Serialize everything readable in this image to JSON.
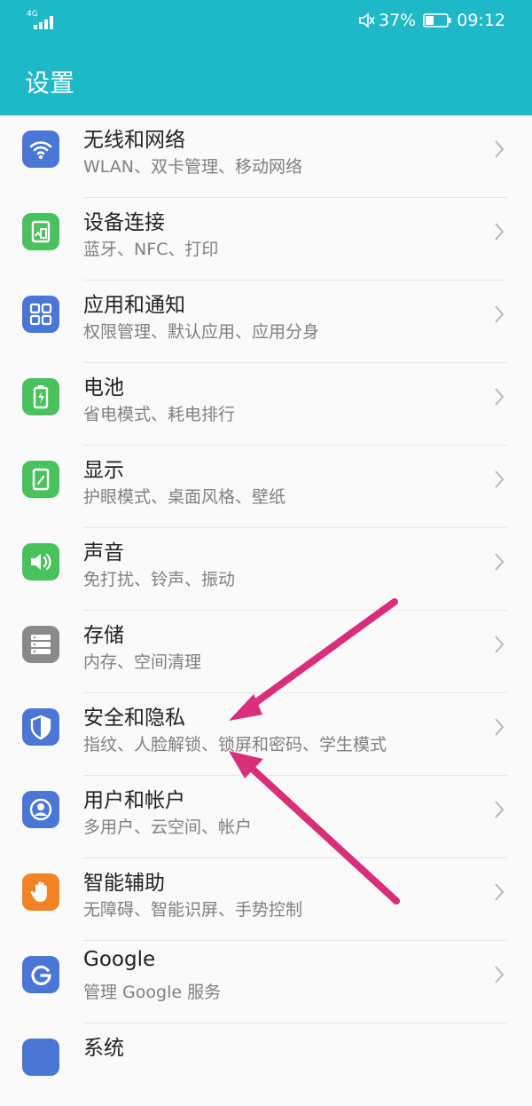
{
  "status_bar": {
    "network": "4G",
    "battery": "37%",
    "time": "09:12",
    "icons": [
      "signal-icon",
      "mute-icon",
      "battery-icon"
    ]
  },
  "app_bar": {
    "title": "设置"
  },
  "colors": {
    "accent": "#1fb8c6",
    "annotation_arrow": "#d92e7a",
    "icon_blue": "#4a76d6",
    "icon_green": "#49c25d",
    "icon_gray": "#8a8a8a",
    "icon_orange": "#f28324"
  },
  "items": [
    {
      "title": "无线和网络",
      "subtitle": "WLAN、双卡管理、移动网络",
      "icon": "wifi-icon"
    },
    {
      "title": "设备连接",
      "subtitle": "蓝牙、NFC、打印",
      "icon": "device-connect-icon"
    },
    {
      "title": "应用和通知",
      "subtitle": "权限管理、默认应用、应用分身",
      "icon": "apps-icon"
    },
    {
      "title": "电池",
      "subtitle": "省电模式、耗电排行",
      "icon": "battery-setting-icon"
    },
    {
      "title": "显示",
      "subtitle": "护眼模式、桌面风格、壁纸",
      "icon": "display-icon"
    },
    {
      "title": "声音",
      "subtitle": "免打扰、铃声、振动",
      "icon": "sound-icon"
    },
    {
      "title": "存储",
      "subtitle": "内存、空间清理",
      "icon": "storage-icon"
    },
    {
      "title": "安全和隐私",
      "subtitle": "指纹、人脸解锁、锁屏和密码、学生模式",
      "icon": "shield-icon"
    },
    {
      "title": "用户和帐户",
      "subtitle": "多用户、云空间、帐户",
      "icon": "user-account-icon"
    },
    {
      "title": "智能辅助",
      "subtitle": "无障碍、智能识屏、手势控制",
      "icon": "hand-icon"
    },
    {
      "title": "Google",
      "subtitle": "管理 Google 服务",
      "icon": "google-icon"
    },
    {
      "title": "系统",
      "subtitle": "",
      "icon": "system-icon"
    }
  ]
}
